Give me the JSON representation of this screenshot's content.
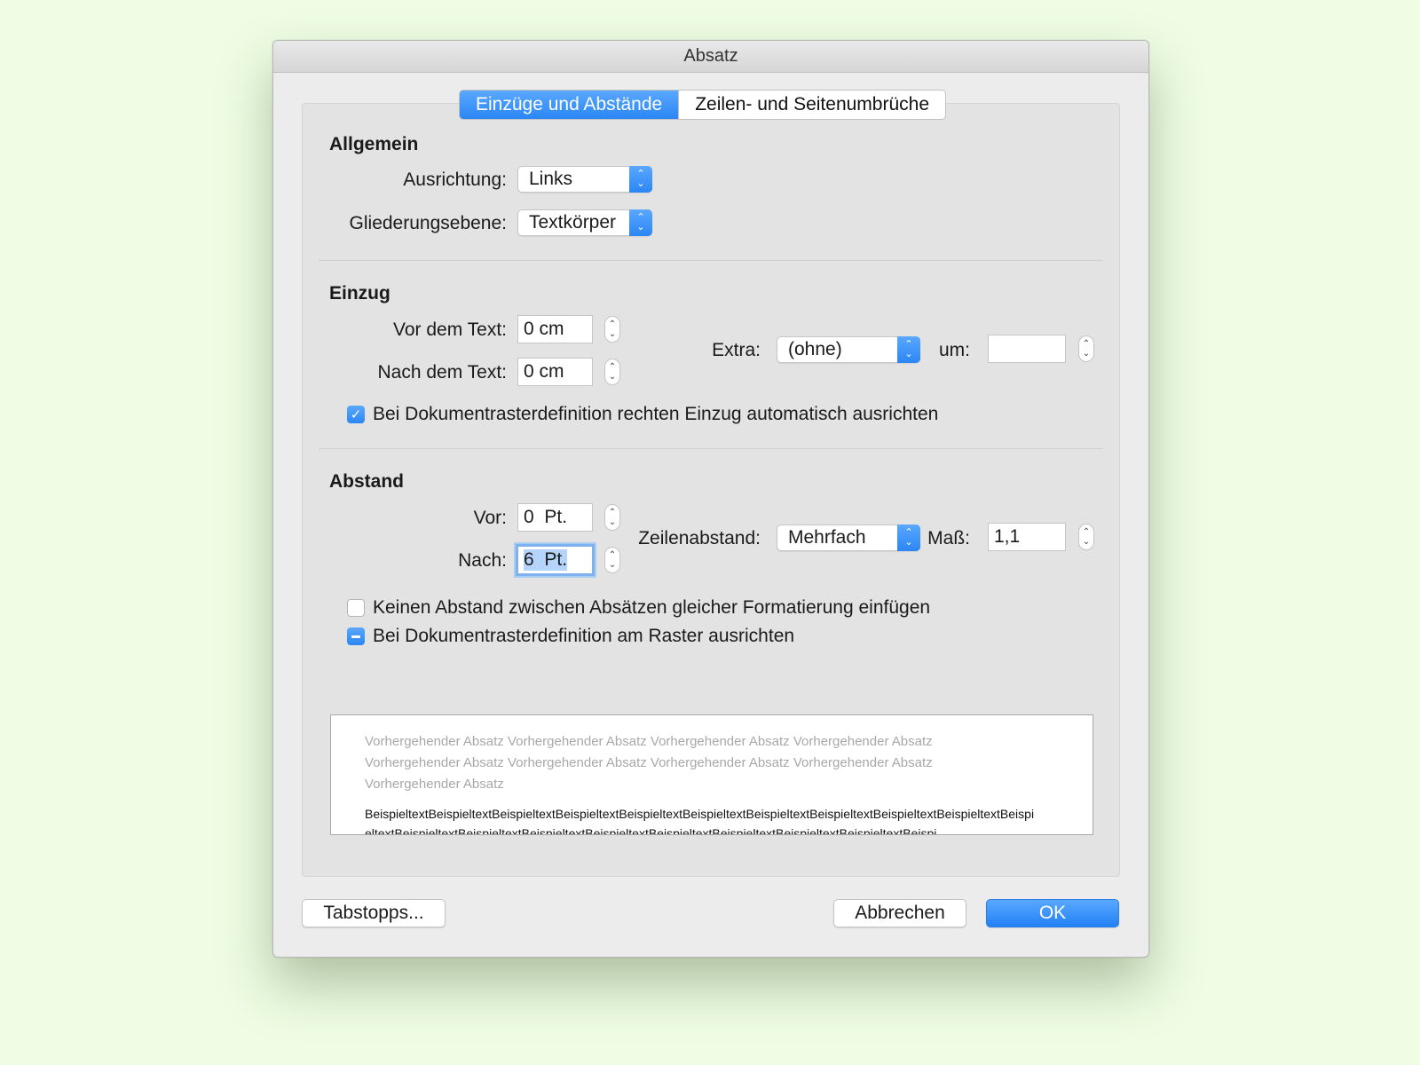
{
  "window": {
    "title": "Absatz"
  },
  "tabs": [
    {
      "label": "Einzüge und Abstände",
      "active": true
    },
    {
      "label": "Zeilen- und Seitenumbrüche",
      "active": false
    }
  ],
  "allgemein": {
    "title": "Allgemein",
    "ausrichtung_label": "Ausrichtung:",
    "ausrichtung_value": "Links",
    "gliederung_label": "Gliederungsebene:",
    "gliederung_value": "Textkörper"
  },
  "einzug": {
    "title": "Einzug",
    "vor_label": "Vor dem Text:",
    "vor_value": "0 cm",
    "nach_label": "Nach dem Text:",
    "nach_value": "0 cm",
    "extra_label": "Extra:",
    "extra_value": "(ohne)",
    "um_label": "um:",
    "um_value": "",
    "checkbox_label": "Bei Dokumentrasterdefinition rechten Einzug automatisch ausrichten",
    "checkbox_state": "checked"
  },
  "abstand": {
    "title": "Abstand",
    "vor_label": "Vor:",
    "vor_value": "0  Pt.",
    "nach_label": "Nach:",
    "nach_value": "6  Pt.",
    "zeilen_label": "Zeilenabstand:",
    "zeilen_value": "Mehrfach",
    "mass_label": "Maß:",
    "mass_value": "1,1",
    "checkbox1_label": "Keinen Abstand zwischen Absätzen gleicher Formatierung einfügen",
    "checkbox1_state": "unchecked",
    "checkbox2_label": "Bei Dokumentrasterdefinition am Raster ausrichten",
    "checkbox2_state": "mixed"
  },
  "preview": {
    "previous_text": "Vorhergehender Absatz Vorhergehender Absatz Vorhergehender Absatz Vorhergehender Absatz Vorhergehender Absatz Vorhergehender Absatz Vorhergehender Absatz Vorhergehender Absatz Vorhergehender Absatz",
    "sample_text": "BeispieltextBeispieltextBeispieltextBeispieltextBeispieltextBeispieltextBeispieltextBeispieltextBeispieltextBeispieltextBeispieltextBeispieltextBeispieltextBeispieltextBeispieltextBeispieltextBeispieltextBeispieltextBeispieltextBeispi"
  },
  "buttons": {
    "tabstopps": "Tabstopps...",
    "abbrechen": "Abbrechen",
    "ok": "OK"
  },
  "colors": {
    "accent": "#2b86f4",
    "background": "#eefde3",
    "dialog": "#ececec"
  }
}
